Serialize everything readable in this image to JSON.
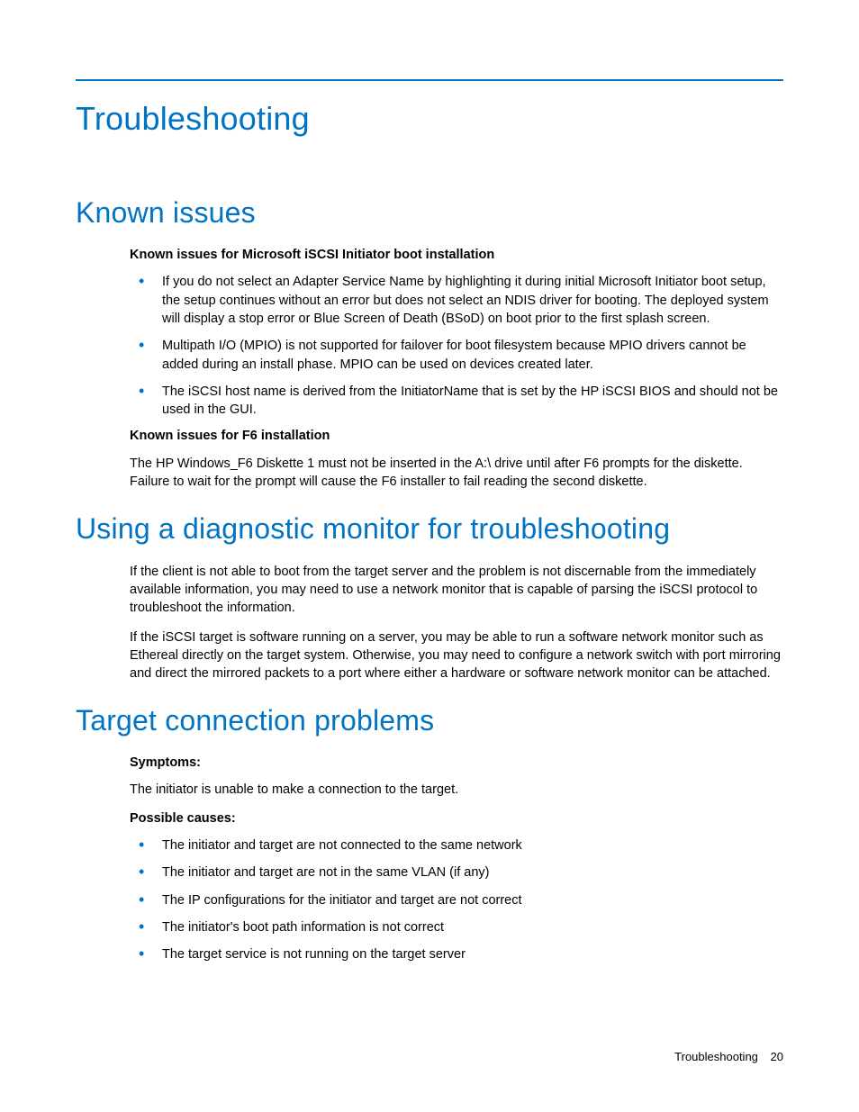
{
  "title": "Troubleshooting",
  "sections": {
    "known_issues": {
      "heading": "Known issues",
      "sub1": "Known issues for Microsoft iSCSI Initiator boot installation",
      "bullets1": [
        "If you do not select an Adapter Service Name by highlighting it during initial Microsoft Initiator boot setup, the setup continues without an error but does not select an NDIS driver for booting. The deployed system will display a stop error or Blue Screen of Death (BSoD) on boot prior to the first splash screen.",
        "Multipath I/O (MPIO) is not supported for failover for boot filesystem because MPIO drivers cannot be added during an install phase. MPIO can be used on devices created later.",
        "The iSCSI host name is derived from the InitiatorName that is set by the HP iSCSI BIOS and should not be used in the GUI."
      ],
      "sub2": "Known issues for F6 installation",
      "para2": "The HP Windows_F6 Diskette 1 must not be inserted in the A:\\ drive until after F6 prompts for the diskette. Failure to wait for the prompt will cause the F6 installer to fail reading the second diskette."
    },
    "diagnostic": {
      "heading": "Using a diagnostic monitor for troubleshooting",
      "para1": "If the client is not able to boot from the target server and the problem is not discernable from the immediately available information, you may need to use a network monitor that is capable of parsing the iSCSI protocol to troubleshoot the information.",
      "para2": "If the iSCSI target is software running on a server, you may be able to run a software network monitor such as Ethereal directly on the target system. Otherwise, you may need to configure a network switch with port mirroring and direct the mirrored packets to a port where either a hardware or software network monitor can be attached."
    },
    "target_connection": {
      "heading": "Target connection problems",
      "symptoms_label": "Symptoms:",
      "symptoms_text": "The initiator is unable to make a connection to the target.",
      "causes_label": "Possible causes:",
      "causes": [
        "The initiator and target are not connected to the same network",
        "The initiator and target are not in the same VLAN (if any)",
        "The IP configurations for the initiator and target are not correct",
        "The initiator's boot path information is not correct",
        "The target service is not running on the target server"
      ]
    }
  },
  "footer": {
    "label": "Troubleshooting",
    "page": "20"
  }
}
